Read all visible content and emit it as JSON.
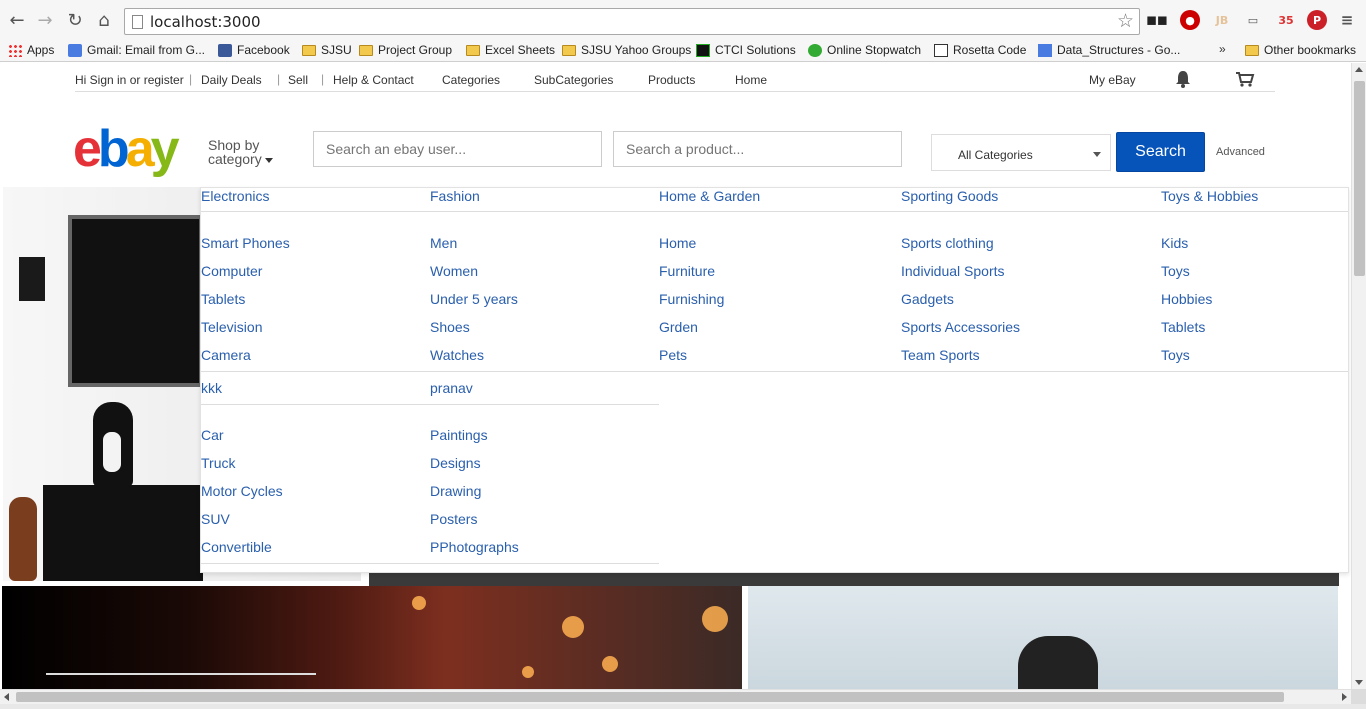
{
  "browser": {
    "url": "localhost:3000",
    "extensions": [
      "mask-icon",
      "stop-icon",
      "jb-icon",
      "cast-icon",
      "badge-icon",
      "pinterest-icon",
      "menu-icon"
    ],
    "extension_badge": "35"
  },
  "bookmarks": {
    "items": [
      {
        "label": "Apps",
        "icon": "apps-icon"
      },
      {
        "label": "Gmail: Email from G...",
        "icon": "google-icon"
      },
      {
        "label": "Facebook",
        "icon": "facebook-icon"
      },
      {
        "label": "SJSU",
        "icon": "folder-icon"
      },
      {
        "label": "Project Group",
        "icon": "folder-icon"
      },
      {
        "label": "Excel Sheets",
        "icon": "folder-icon"
      },
      {
        "label": "SJSU Yahoo Groups",
        "icon": "folder-icon"
      },
      {
        "label": "CTCI Solutions",
        "icon": "ctci-icon"
      },
      {
        "label": "Online Stopwatch",
        "icon": "stopwatch-icon"
      },
      {
        "label": "Rosetta Code",
        "icon": "rosetta-icon"
      },
      {
        "label": "Data_Structures - Go...",
        "icon": "doc-icon"
      }
    ],
    "more": "»",
    "other": "Other bookmarks"
  },
  "top_links": {
    "signin": "Hi Sign in or register",
    "sep": "|",
    "daily_deals": "Daily Deals",
    "sell": "Sell",
    "help": "Help & Contact",
    "categories": "Categories",
    "subcategories": "SubCategories",
    "products": "Products",
    "home": "Home",
    "my_ebay": "My eBay"
  },
  "header": {
    "logo": [
      "e",
      "b",
      "a",
      "y"
    ],
    "shop_by_line1": "Shop by",
    "shop_by_line2": "category",
    "search_user_placeholder": "Search an ebay user...",
    "search_product_placeholder": "Search a product...",
    "category_selected": "All Categories",
    "search_button": "Search",
    "advanced": "Advanced"
  },
  "mega_menu": {
    "groups": [
      {
        "title": "Electronics",
        "items": [
          "Smart Phones",
          "Computer",
          "Tablets",
          "Television",
          "Camera"
        ]
      },
      {
        "title": "Fashion",
        "items": [
          "Men",
          "Women",
          "Under 5 years",
          "Shoes",
          "Watches"
        ]
      },
      {
        "title": "Home & Garden",
        "items": [
          "Home",
          "Furniture",
          "Furnishing",
          "Grden",
          "Pets"
        ]
      },
      {
        "title": "Sporting Goods",
        "items": [
          "Sports clothing",
          "Individual Sports",
          "Gadgets",
          "Sports Accessories",
          "Team Sports"
        ]
      },
      {
        "title": "Toys & Hobbies",
        "items": [
          "Kids",
          "Toys",
          "Hobbies",
          "Tablets",
          "Toys"
        ]
      },
      {
        "title": "kkk",
        "items": [
          "Car",
          "Truck",
          "Motor Cycles",
          "SUV",
          "Convertible"
        ]
      },
      {
        "title": "pranav",
        "items": [
          "Paintings",
          "Designs",
          "Drawing",
          "Posters",
          "PPhotographs"
        ]
      }
    ]
  },
  "colors": {
    "link": "#2a5fad",
    "search_button": "#0654ba",
    "logo_e": "#e53238",
    "logo_b": "#0064d2",
    "logo_a": "#f5af02",
    "logo_y": "#86b817"
  }
}
